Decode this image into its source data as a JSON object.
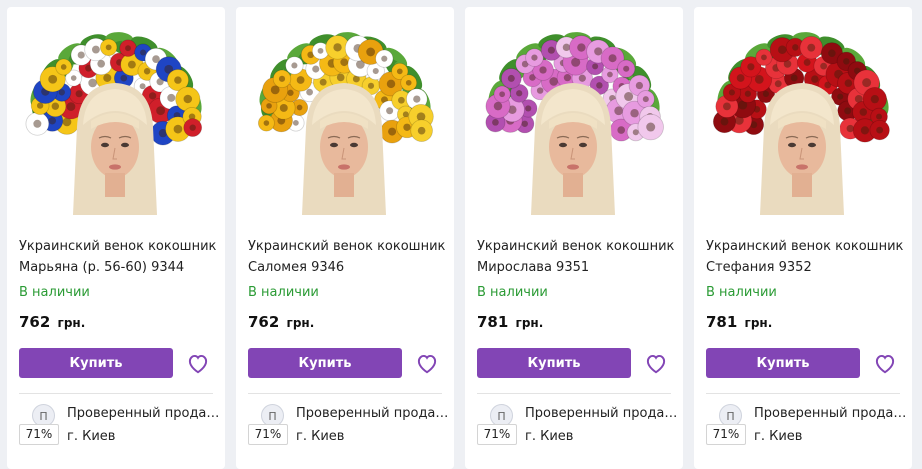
{
  "products": [
    {
      "title_line1": "Украинский венок кокошник",
      "title_line2": "Марьяна (р. 56-60) 9344",
      "availability": "В наличии",
      "price": "762",
      "currency": "грн.",
      "buy_label": "Купить",
      "favorite_icon": "heart-icon",
      "seller": {
        "badge": "П",
        "rating": "71%",
        "name": "Проверенный продав...",
        "city": "г. Киев"
      },
      "palette": [
        "#d01f2a",
        "#1f45c4",
        "#f5c518",
        "#ffffff"
      ]
    },
    {
      "title_line1": "Украинский венок кокошник",
      "title_line2": "Саломея 9346",
      "availability": "В наличии",
      "price": "762",
      "currency": "грн.",
      "buy_label": "Купить",
      "favorite_icon": "heart-icon",
      "seller": {
        "badge": "П",
        "rating": "71%",
        "name": "Проверенный продав...",
        "city": "г. Киев"
      },
      "palette": [
        "#f5b915",
        "#f7cf2c",
        "#ffffff",
        "#e9a10e"
      ]
    },
    {
      "title_line1": "Украинский венок кокошник",
      "title_line2": "Мирослава 9351",
      "availability": "В наличии",
      "price": "781",
      "currency": "грн.",
      "buy_label": "Купить",
      "favorite_icon": "heart-icon",
      "seller": {
        "badge": "П",
        "rating": "71%",
        "name": "Проверенный продав...",
        "city": "г. Киев"
      },
      "palette": [
        "#d86bc6",
        "#e79be0",
        "#b24fb0",
        "#f1c8ec"
      ]
    },
    {
      "title_line1": "Украинский венок кокошник",
      "title_line2": "Стефания 9352",
      "availability": "В наличии",
      "price": "781",
      "currency": "грн.",
      "buy_label": "Купить",
      "favorite_icon": "heart-icon",
      "seller": {
        "badge": "П",
        "rating": "71%",
        "name": "Проверенный продав...",
        "city": "г. Киев"
      },
      "palette": [
        "#d3141c",
        "#b80f15",
        "#e8323a",
        "#8f0b10"
      ]
    }
  ],
  "colors": {
    "accent": "#8245b5",
    "in_stock": "#2b9b35",
    "background": "#eef0f4"
  }
}
